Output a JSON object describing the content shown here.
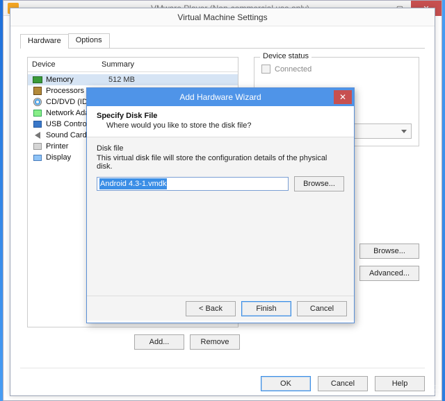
{
  "player": {
    "title": "VMware Player (Non-commercial use only)"
  },
  "settings": {
    "title": "Virtual Machine Settings",
    "tabs": {
      "hardware": "Hardware",
      "options": "Options"
    },
    "columns": {
      "device": "Device",
      "summary": "Summary"
    },
    "devices": [
      {
        "name": "Memory",
        "summary": "512 MB"
      },
      {
        "name": "Processors",
        "summary": ""
      },
      {
        "name": "CD/DVD (IDE)",
        "summary": ""
      },
      {
        "name": "Network Adap",
        "summary": ""
      },
      {
        "name": "USB Controller",
        "summary": ""
      },
      {
        "name": "Sound Card",
        "summary": ""
      },
      {
        "name": "Printer",
        "summary": ""
      },
      {
        "name": "Display",
        "summary": ""
      }
    ],
    "status_group": "Device status",
    "status_connected": "Connected",
    "browse": "Browse...",
    "advanced": "Advanced...",
    "add": "Add...",
    "remove": "Remove",
    "ok": "OK",
    "cancel": "Cancel",
    "help": "Help"
  },
  "wizard": {
    "title": "Add Hardware Wizard",
    "heading": "Specify Disk File",
    "subheading": "Where would you like to store the disk file?",
    "section_label": "Disk file",
    "section_desc": "This virtual disk file will store the configuration details of the physical disk.",
    "input_value": "Android 4.3-1.vmdk",
    "browse": "Browse...",
    "back": "< Back",
    "finish": "Finish",
    "cancel": "Cancel"
  }
}
